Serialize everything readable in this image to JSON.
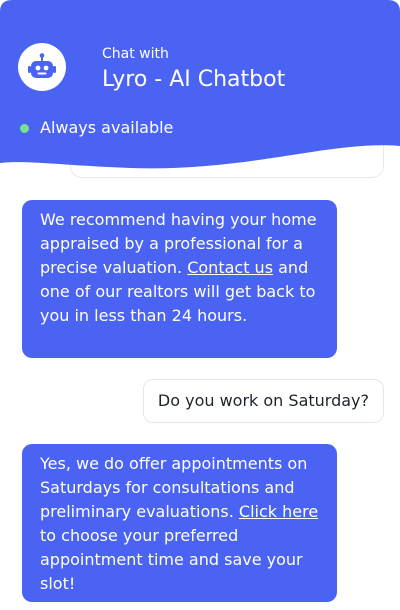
{
  "header": {
    "subtitle": "Chat with",
    "title": "Lyro - AI Chatbot",
    "status": "Always available",
    "colors": {
      "primary": "#4a63f3",
      "status_dot": "#78e08f"
    },
    "avatar_icon": "robot-icon"
  },
  "messages": [
    {
      "sender": "bot",
      "parts": {
        "before": "We recommend having your home appraised by a professional for a precise valuation. ",
        "link": "Contact us",
        "after": " and one of our realtors will get back to you in less than 24 hours."
      }
    },
    {
      "sender": "user",
      "text": "Do you work on Saturday?"
    },
    {
      "sender": "bot",
      "parts": {
        "before": "Yes, we do offer appointments on Saturdays for consultations and preliminary evaluations. ",
        "link": "Click here",
        "after": " to choose your preferred appointment time and save your slot!"
      }
    }
  ]
}
